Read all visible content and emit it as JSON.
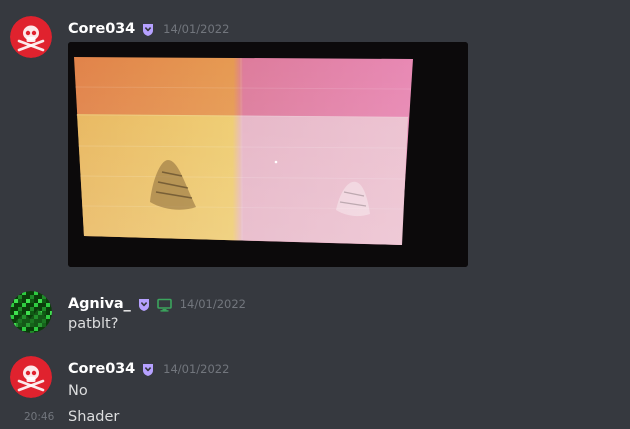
{
  "messages": [
    {
      "author": "Core034",
      "date": "14/01/2022",
      "badge_icon": "nitro-shield-badge-icon",
      "avatar_icon": "skull-crossbones-avatar",
      "attachment": {
        "kind": "photo",
        "subject": "monitor-with-pink-orange-color-blocks"
      }
    },
    {
      "author": "Agniva_",
      "date": "14/01/2022",
      "badge_icon": "nitro-shield-badge-icon",
      "device_icon": "desktop-monitor-icon",
      "avatar_icon": "green-pixel-avatar",
      "text": "patblt?"
    },
    {
      "author": "Core034",
      "date": "14/01/2022",
      "badge_icon": "nitro-shield-badge-icon",
      "avatar_icon": "skull-crossbones-avatar",
      "text": "No",
      "followups": [
        {
          "time": "20:46",
          "text": "Shader"
        }
      ]
    }
  ],
  "colors": {
    "background": "#36393f",
    "username": "#ffffff",
    "message_text": "#dcddde",
    "timestamp": "#72767d",
    "badge": "#b6a1ff",
    "device_online": "#3ba55d",
    "avatar_red": "#e0222e"
  }
}
